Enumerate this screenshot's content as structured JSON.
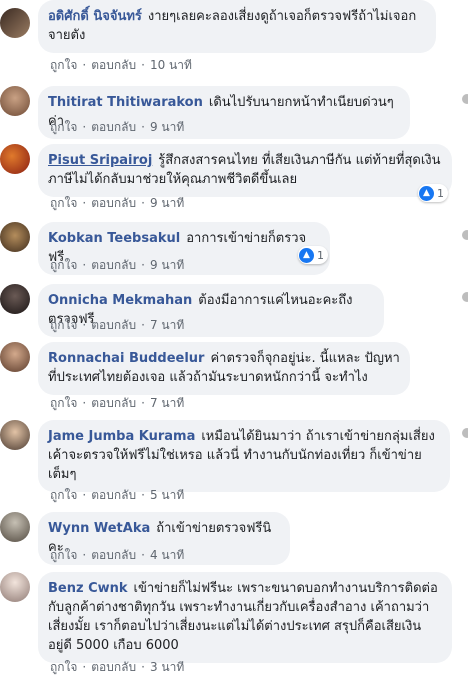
{
  "actions": {
    "like": "ถูกใจ",
    "reply": "ตอบกลับ",
    "separator": "·"
  },
  "comments": [
    {
      "author": "อดิศักดิ์ นิจจันทร์",
      "text": "งายๆเลยคะลองเสี่ยงดูถ้าเจอก็ตรวจฟรีถ้าไม่เจอกจายตัง",
      "time": "10 นาที",
      "reactions": ""
    },
    {
      "author": "Thitirat Thitiwarakon",
      "text": "เดินไปรับนายกหน้าทำเนียบด่วนๆค่า",
      "time": "9 นาที",
      "reactions": ""
    },
    {
      "author": "Pisut Sripairoj",
      "text": "รู้สึกสงสารคนไทย ที่เสียเงินภาษีกัน แต่ท้ายที่สุดเงินภาษีไม่ได้กลับมาช่วยให้คุณภาพชีวิตดีขึ้นเลย",
      "time": "9 นาที",
      "reactions": "1"
    },
    {
      "author": "Kobkan Teebsakul",
      "text": "อาการเข้าข่ายก็ตรวจฟรี",
      "time": "9 นาที",
      "reactions": "1"
    },
    {
      "author": "Onnicha Mekmahan",
      "text": "ต้องมีอาการแค่ไหนอะคะถึงตรวจฟรี",
      "time": "7 นาที",
      "reactions": ""
    },
    {
      "author": "Ronnachai Buddeelur",
      "text": "ค่าตรวจก็จุกอยู่น่ะ. นี้แหละ ปัญหาที่ประเทศไทยต้องเจอ แล้วถ้ามันระบาดหนักกว่านี้ จะทำไง",
      "time": "7 นาที",
      "reactions": ""
    },
    {
      "author": "Jame Jumba Kurama",
      "text": "เหมือนได้ยินมาว่า ถ้าเราเข้าข่ายกลุ่มเสี่ยง เค้าจะตรวจให้ฟรีไม่ใช่เหรอ แล้วนี่ ทำงานกับนักท่องเที่ยว ก็เข้าข่ายเต็มๆ",
      "time": "5 นาที",
      "reactions": ""
    },
    {
      "author": "Wynn WetAka",
      "text": "ถ้าเข้าข่ายตรวจฟรีนิคะ",
      "time": "4 นาที",
      "reactions": ""
    },
    {
      "author": "Benz Cwnk",
      "text": "เข้าข่ายก็ไม่ฟรีนะ เพราะขนาดบอกทำงานบริการติดต่อกับลูกค้าต่างชาติทุกวัน เพราะทำงานเกี่ยวกับเครื่องสำอาง เค้าถามว่าเสี่ยงมั้ย เราก็ตอบไปว่าเสี่ยงนะแต่ไม่ได้ต่างประเทศ สรุปก็คือเสียเงินอยู่ดี 5000 เกือบ 6000",
      "time": "3 นาที",
      "reactions": ""
    }
  ],
  "colors": {
    "author": "#385898",
    "bubble": "#f0f2f5",
    "meta": "#606770",
    "like": "#1877f2"
  }
}
